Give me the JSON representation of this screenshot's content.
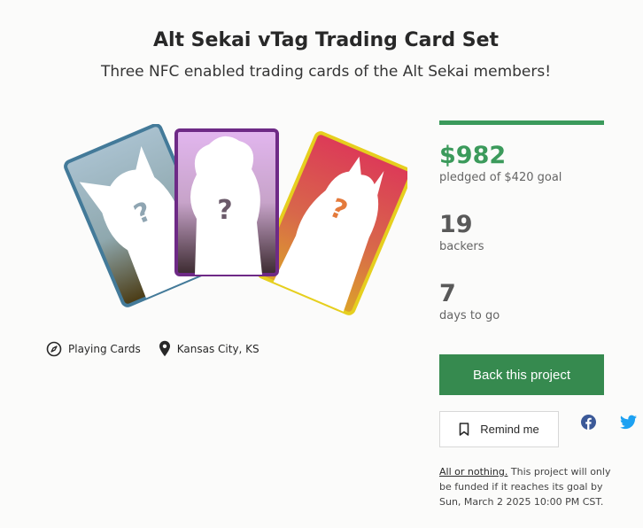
{
  "project": {
    "title": "Alt Sekai vTag Trading Card Set",
    "subtitle": "Three NFC enabled trading cards of the Alt Sekai members!"
  },
  "meta": {
    "category": "Playing Cards",
    "location": "Kansas City, KS"
  },
  "stats": {
    "pledged_amount": "$982",
    "pledged_label": "pledged of $420 goal",
    "backers_count": "19",
    "backers_label": "backers",
    "days_count": "7",
    "days_label": "days to go"
  },
  "actions": {
    "back_label": "Back this project",
    "remind_label": "Remind me"
  },
  "funding_note": {
    "lead": "All or nothing.",
    "body": " This project will only be funded if it reaches its goal by Sun, March 2 2025 10:00 PM CST."
  },
  "colors": {
    "accent_green": "#3b9a5b",
    "button_green": "#368a4f",
    "facebook": "#3b5998",
    "twitter": "#1da1f2"
  },
  "icons": [
    "compass-icon",
    "location-pin-icon",
    "bookmark-icon",
    "facebook-icon",
    "twitter-icon"
  ]
}
